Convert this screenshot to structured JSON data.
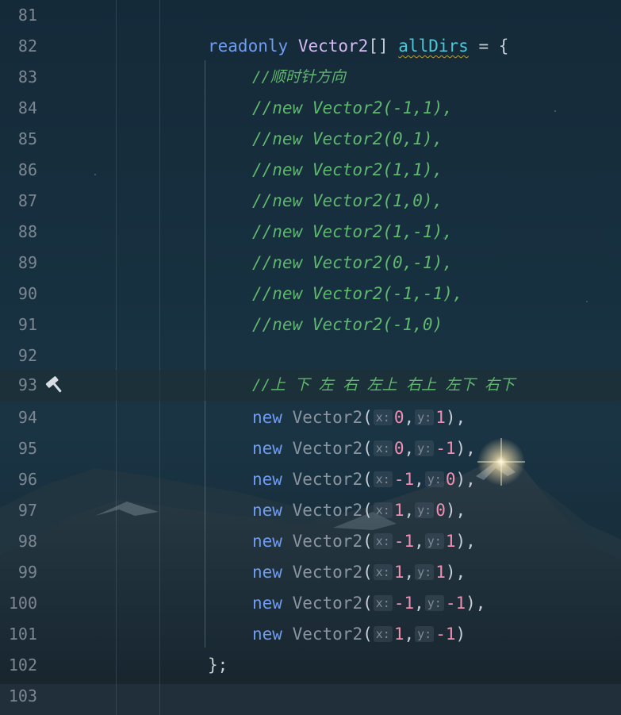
{
  "editor": {
    "lines": [
      {
        "num": "81"
      },
      {
        "num": "82",
        "keyword": "readonly",
        "type": "Vector2",
        "brackets": "[]",
        "field": "allDirs",
        "rest": " = {"
      },
      {
        "num": "83",
        "comment": "//顺时针方向"
      },
      {
        "num": "84",
        "comment": "//new Vector2(-1,1),"
      },
      {
        "num": "85",
        "comment": "//new Vector2(0,1),"
      },
      {
        "num": "86",
        "comment": "//new Vector2(1,1),"
      },
      {
        "num": "87",
        "comment": "//new Vector2(1,0),"
      },
      {
        "num": "88",
        "comment": "//new Vector2(1,-1),"
      },
      {
        "num": "89",
        "comment": "//new Vector2(0,-1),"
      },
      {
        "num": "90",
        "comment": "//new Vector2(-1,-1),"
      },
      {
        "num": "91",
        "comment": "//new Vector2(-1,0)"
      },
      {
        "num": "92"
      },
      {
        "num": "93",
        "comment": "//上 下 左 右 左上 右上 左下 右下"
      },
      {
        "num": "94",
        "x": "0",
        "y": "1",
        "end": "),"
      },
      {
        "num": "95",
        "x": "0",
        "y": "-1",
        "end": "),"
      },
      {
        "num": "96",
        "x": "-1",
        "y": "0",
        "end": "),"
      },
      {
        "num": "97",
        "x": "1",
        "y": "0",
        "end": "),"
      },
      {
        "num": "98",
        "x": "-1",
        "y": "1",
        "end": "),"
      },
      {
        "num": "99",
        "x": "1",
        "y": "1",
        "end": "),"
      },
      {
        "num": "100",
        "x": "-1",
        "y": "-1",
        "end": "),"
      },
      {
        "num": "101",
        "x": "1",
        "y": "-1",
        "end": ")"
      },
      {
        "num": "102",
        "closing": "};"
      },
      {
        "num": "103"
      }
    ],
    "call": {
      "keyword": "new",
      "class": "Vector2",
      "open": "(",
      "x_hint": "x:",
      "y_hint": "y:",
      "sep": ","
    },
    "current_line_icon": "hammer-icon"
  },
  "colors": {
    "keyword": "#6f9cf0",
    "comment": "#5fb86d",
    "number": "#ef8fb3",
    "field": "#4bc7d8",
    "type": "#d4b9f2"
  }
}
